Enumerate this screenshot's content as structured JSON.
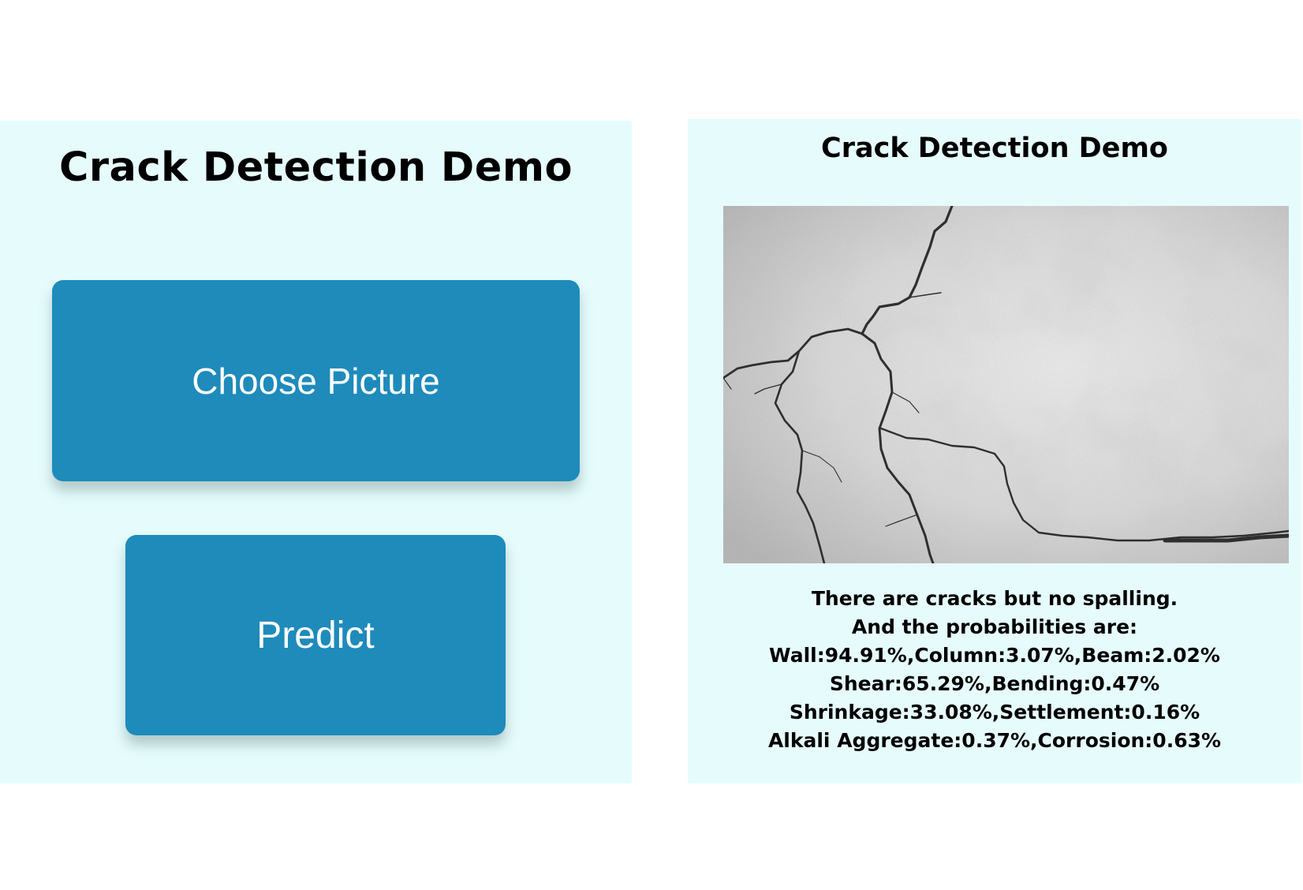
{
  "left": {
    "title": "Crack Detection Demo",
    "choose_label": "Choose Picture",
    "predict_label": "Predict"
  },
  "right": {
    "title": "Crack Detection Demo",
    "result_lines": [
      "There are cracks but no spalling.",
      "And the probabilities are:",
      "Wall:94.91%,Column:3.07%,Beam:2.02%",
      "Shear:65.29%,Bending:0.47%",
      "Shrinkage:33.08%,Settlement:0.16%",
      "Alkali Aggregate:0.37%,Corrosion:0.63%"
    ]
  },
  "colors": {
    "panel_bg": "#e6fcfc",
    "button_bg": "#1e8bbb",
    "button_text": "#ffffff"
  }
}
